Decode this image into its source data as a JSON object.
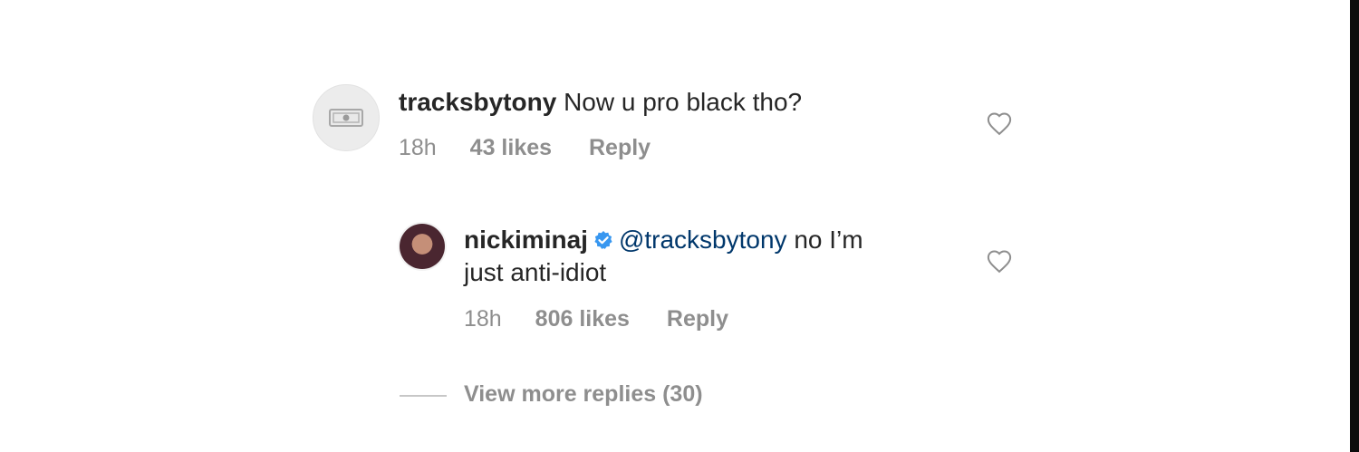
{
  "comment": {
    "username": "tracksbytony",
    "text": "Now u pro black tho?",
    "time": "18h",
    "likes": "43 likes",
    "reply_label": "Reply",
    "avatar_icon": "dollar-bill-icon",
    "like_icon": "heart-outline-icon"
  },
  "reply": {
    "username": "nickiminaj",
    "verified_icon": "verified-badge-icon",
    "mention": "@tracksbytony",
    "text_line1": "no I’m",
    "text_line2": "just anti-idiot",
    "time": "18h",
    "likes": "806 likes",
    "reply_label": "Reply",
    "like_icon": "heart-outline-icon"
  },
  "view_more": {
    "label": "View more replies (30)"
  },
  "colors": {
    "username": "#262626",
    "meta": "#8e8e8e",
    "mention": "#00376b",
    "verified": "#3897f0",
    "border": "#0c0c0c"
  }
}
